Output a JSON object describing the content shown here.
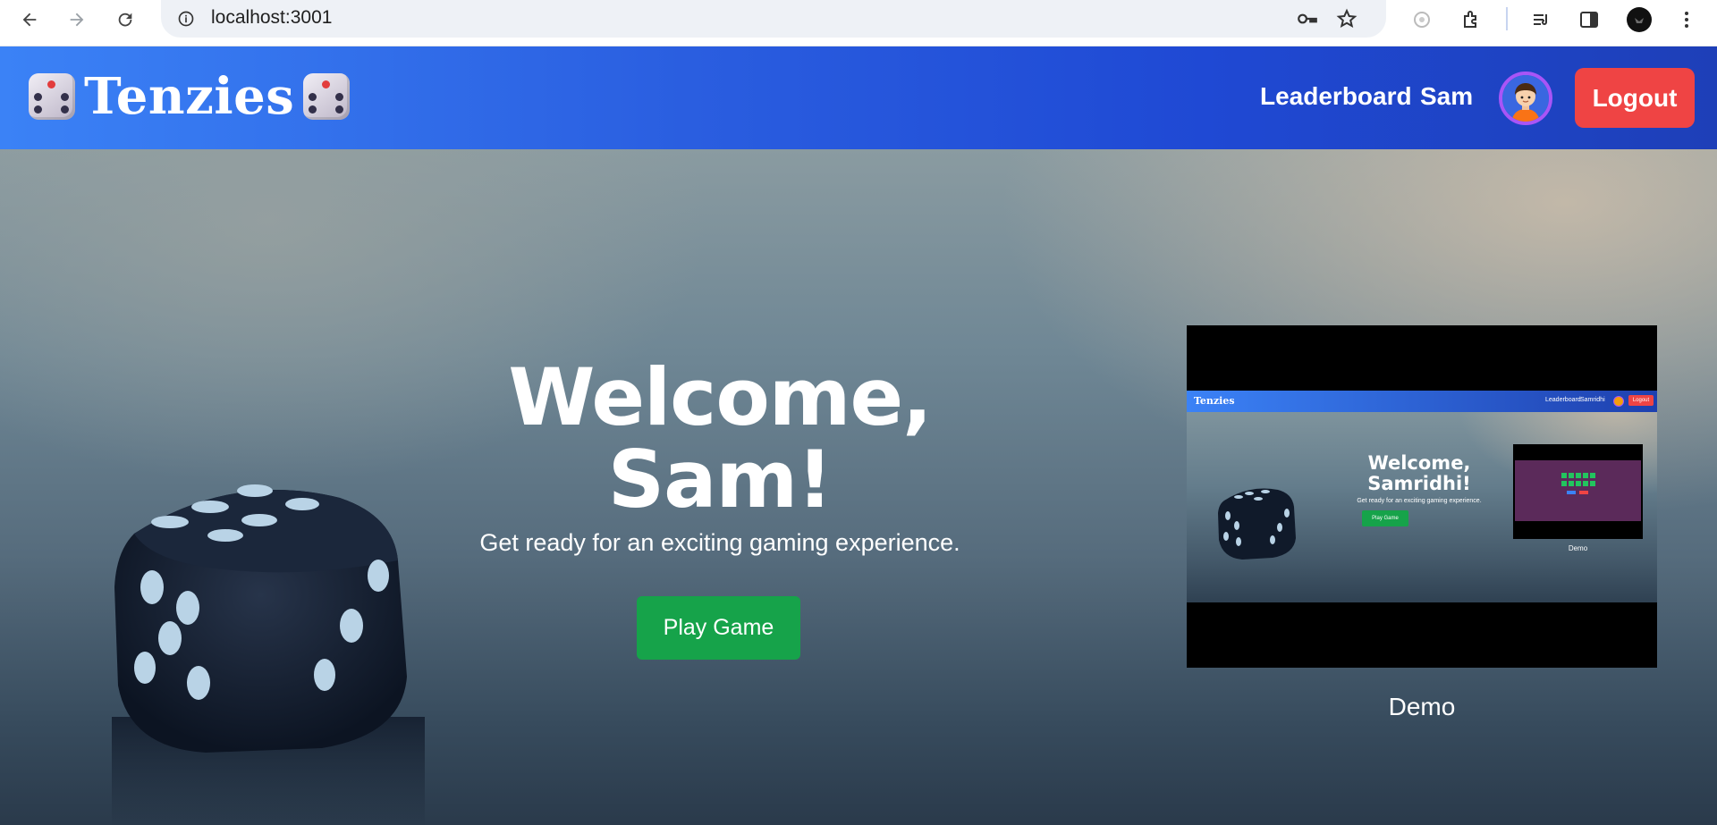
{
  "browser": {
    "url": "localhost:3001",
    "icons": [
      "back-arrow-icon",
      "forward-arrow-icon",
      "reload-icon",
      "site-info-icon",
      "password-key-icon",
      "bookmark-star-icon",
      "lens-icon",
      "extensions-icon",
      "reading-list-icon",
      "side-panel-icon",
      "profile-icon",
      "menu-kebab-icon"
    ]
  },
  "navbar": {
    "brand": "Tenzies",
    "links": [
      "Leaderboard",
      "Sam"
    ],
    "logout_label": "Logout",
    "colors": {
      "gradient_start": "#3b82f6",
      "gradient_end": "#1e3fb8",
      "logout": "#ef4444",
      "avatar_ring": "#a855f7"
    }
  },
  "hero": {
    "welcome_line1": "Welcome,",
    "welcome_line2": "Sam!",
    "subtitle": "Get ready for an exciting gaming experience.",
    "play_label": "Play Game",
    "play_color": "#16a34a"
  },
  "demo": {
    "caption": "Demo",
    "preview": {
      "brand": "Tenzies",
      "links": [
        "Leaderboard",
        "Samridhi"
      ],
      "logout_label": "Logout",
      "welcome_line1": "Welcome,",
      "welcome_line2": "Samridhi!",
      "subtitle": "Get ready for an exciting gaming experience.",
      "play_label": "Play Game",
      "caption": "Demo"
    }
  }
}
